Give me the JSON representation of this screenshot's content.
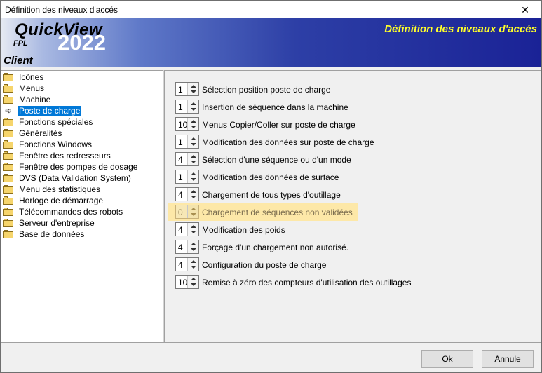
{
  "window": {
    "title": "Définition des niveaux d'accés",
    "close": "✕"
  },
  "banner": {
    "brand": "QuickView",
    "year": "2022",
    "fpl": "FPL",
    "client": "Client",
    "heading": "Définition des niveaux d'accés"
  },
  "tree": {
    "selected_index": 3,
    "items": [
      {
        "label": "Icônes"
      },
      {
        "label": "Menus"
      },
      {
        "label": "Machine"
      },
      {
        "label": "Poste de charge"
      },
      {
        "label": "Fonctions spéciales"
      },
      {
        "label": "Généralités"
      },
      {
        "label": "Fonctions Windows"
      },
      {
        "label": "Fenêtre des redresseurs"
      },
      {
        "label": "Fenêtre des pompes de dosage"
      },
      {
        "label": "DVS (Data Validation System)"
      },
      {
        "label": "Menu des statistiques"
      },
      {
        "label": "Horloge de démarrage"
      },
      {
        "label": "Télécommandes des robots"
      },
      {
        "label": "Serveur d'entreprise"
      },
      {
        "label": "Base de données"
      }
    ]
  },
  "levels": [
    {
      "value": "1",
      "label": "Sélection position poste de charge"
    },
    {
      "value": "1",
      "label": "Insertion de séquence dans la machine"
    },
    {
      "value": "10",
      "label": "Menus Copier/Coller sur poste de charge"
    },
    {
      "value": "1",
      "label": "Modification des données sur poste de charge"
    },
    {
      "value": "4",
      "label": "Sélection d'une séquence ou d'un mode"
    },
    {
      "value": "1",
      "label": "Modification des données de surface"
    },
    {
      "value": "4",
      "label": "Chargement de tous types d'outillage"
    },
    {
      "value": "0",
      "label": "Chargement de séquences non validées"
    },
    {
      "value": "4",
      "label": "Modification des poids"
    },
    {
      "value": "4",
      "label": "Forçage d'un chargement non autorisé."
    },
    {
      "value": "4",
      "label": "Configuration du poste de charge"
    },
    {
      "value": "10",
      "label": "Remise à zéro des compteurs d'utilisation des outillages"
    }
  ],
  "buttons": {
    "ok": "Ok",
    "cancel": "Annule"
  }
}
